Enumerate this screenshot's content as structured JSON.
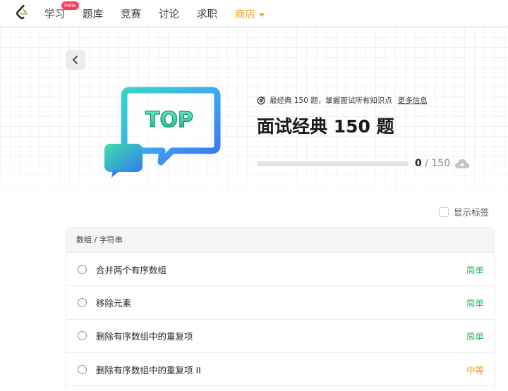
{
  "nav": {
    "items": [
      {
        "label": "学习",
        "badge": "new"
      },
      {
        "label": "题库"
      },
      {
        "label": "竞赛"
      },
      {
        "label": "讨论"
      },
      {
        "label": "求职"
      },
      {
        "label": "商店",
        "dropdown": true
      }
    ],
    "shop_color": "#f0a020"
  },
  "hero": {
    "illustration_text": "TOP",
    "subtitle": "最经典 150 题，掌握面试所有知识点",
    "more_info": "更多信息",
    "title": "面试经典 150 题",
    "progress": {
      "solved": "0",
      "separator": "/",
      "total": "150",
      "fraction": 0
    }
  },
  "tag_toggle": {
    "label": "显示标签",
    "checked": false
  },
  "list": {
    "section": "数组 / 字符串",
    "problems": [
      {
        "name": "合并两个有序数组",
        "difficulty": "简单",
        "color": "#2db55d"
      },
      {
        "name": "移除元素",
        "difficulty": "简单",
        "color": "#2db55d"
      },
      {
        "name": "删除有序数组中的重复项",
        "difficulty": "简单",
        "color": "#2db55d"
      },
      {
        "name": "删除有序数组中的重复项 II",
        "difficulty": "中等",
        "color": "#f0a020"
      }
    ]
  },
  "icons": {
    "logo": "leetcode-logo-icon",
    "back": "chevron-left-icon",
    "target": "target-icon",
    "cloud": "cloud-sync-icon",
    "status": "circle-status-icon"
  }
}
